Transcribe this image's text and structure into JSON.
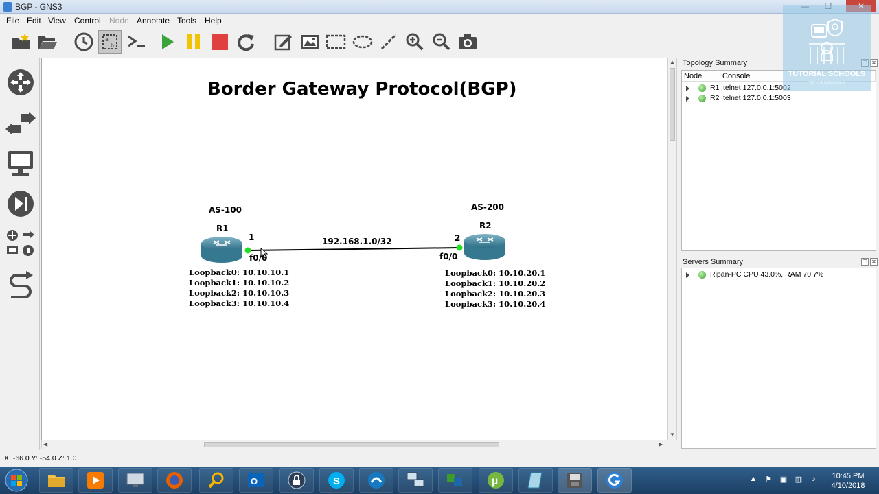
{
  "window": {
    "title": "BGP - GNS3",
    "minimize": "—",
    "maximize": "☐",
    "close": "✕"
  },
  "menu": {
    "file": "File",
    "edit": "Edit",
    "view": "View",
    "control": "Control",
    "node": "Node",
    "annotate": "Annotate",
    "tools": "Tools",
    "help": "Help"
  },
  "toolbar": {
    "icons": [
      "new-project-icon",
      "open-project-icon",
      "snapshot-icon",
      "show-interface-labels-icon",
      "console-all-icon",
      "start-all-icon",
      "suspend-all-icon",
      "stop-all-icon",
      "reload-all-icon",
      "add-note-icon",
      "insert-picture-icon",
      "draw-rectangle-icon",
      "draw-ellipse-icon",
      "draw-line-icon",
      "zoom-in-icon",
      "zoom-out-icon",
      "screenshot-icon"
    ],
    "colors": {
      "start": "#3aa33a",
      "suspend": "#f0c400",
      "stop": "#e04040"
    }
  },
  "canvas": {
    "heading": "Border Gateway Protocol(BGP)",
    "as_left": "AS-100",
    "as_right": "AS-200",
    "r1_label": "R1",
    "r2_label": "R2",
    "r1_port": "1",
    "r2_port": "2",
    "r1_iface": "f0/0",
    "r2_iface": "f0/0",
    "link_label": "192.168.1.0/32",
    "link_status_color": "#22dd22",
    "r1_loopbacks": [
      "Loopback0: 10.10.10.1",
      "Loopback1: 10.10.10.2",
      "Loopback2: 10.10.10.3",
      "Loopback3: 10.10.10.4"
    ],
    "r2_loopbacks": [
      "Loopback0: 10.10.20.1",
      "Loopback1: 10.10.20.2",
      "Loopback2: 10.10.20.3",
      "Loopback3: 10.10.20.4"
    ]
  },
  "topology_summary": {
    "title": "Topology Summary",
    "columns": [
      "Node",
      "Console"
    ],
    "rows": [
      {
        "node": "R1",
        "console": "telnet 127.0.0.1:5002"
      },
      {
        "node": "R2",
        "console": "telnet 127.0.0.1:5003"
      }
    ]
  },
  "servers_summary": {
    "title": "Servers Summary",
    "rows": [
      {
        "label": "Ripan-PC CPU 43.0%, RAM 70.7%"
      }
    ]
  },
  "statusbar": {
    "coords": "X: -66.0 Y: -54.0 Z: 1.0"
  },
  "watermark": {
    "name": "TUTORIAL SCHOOLS",
    "tagline": "TRY THE IMPOSSIBLE"
  },
  "taskbar": {
    "apps": [
      "start-orb",
      "file-explorer",
      "media-player",
      "remote-desktop",
      "firefox",
      "search-tool",
      "outlook",
      "security-app",
      "skype",
      "wireshark",
      "network-app",
      "vm-app",
      "utorrent",
      "notepad-app",
      "disk-app",
      "gns3"
    ],
    "time": "10:45 PM",
    "date": "4/10/2018"
  }
}
